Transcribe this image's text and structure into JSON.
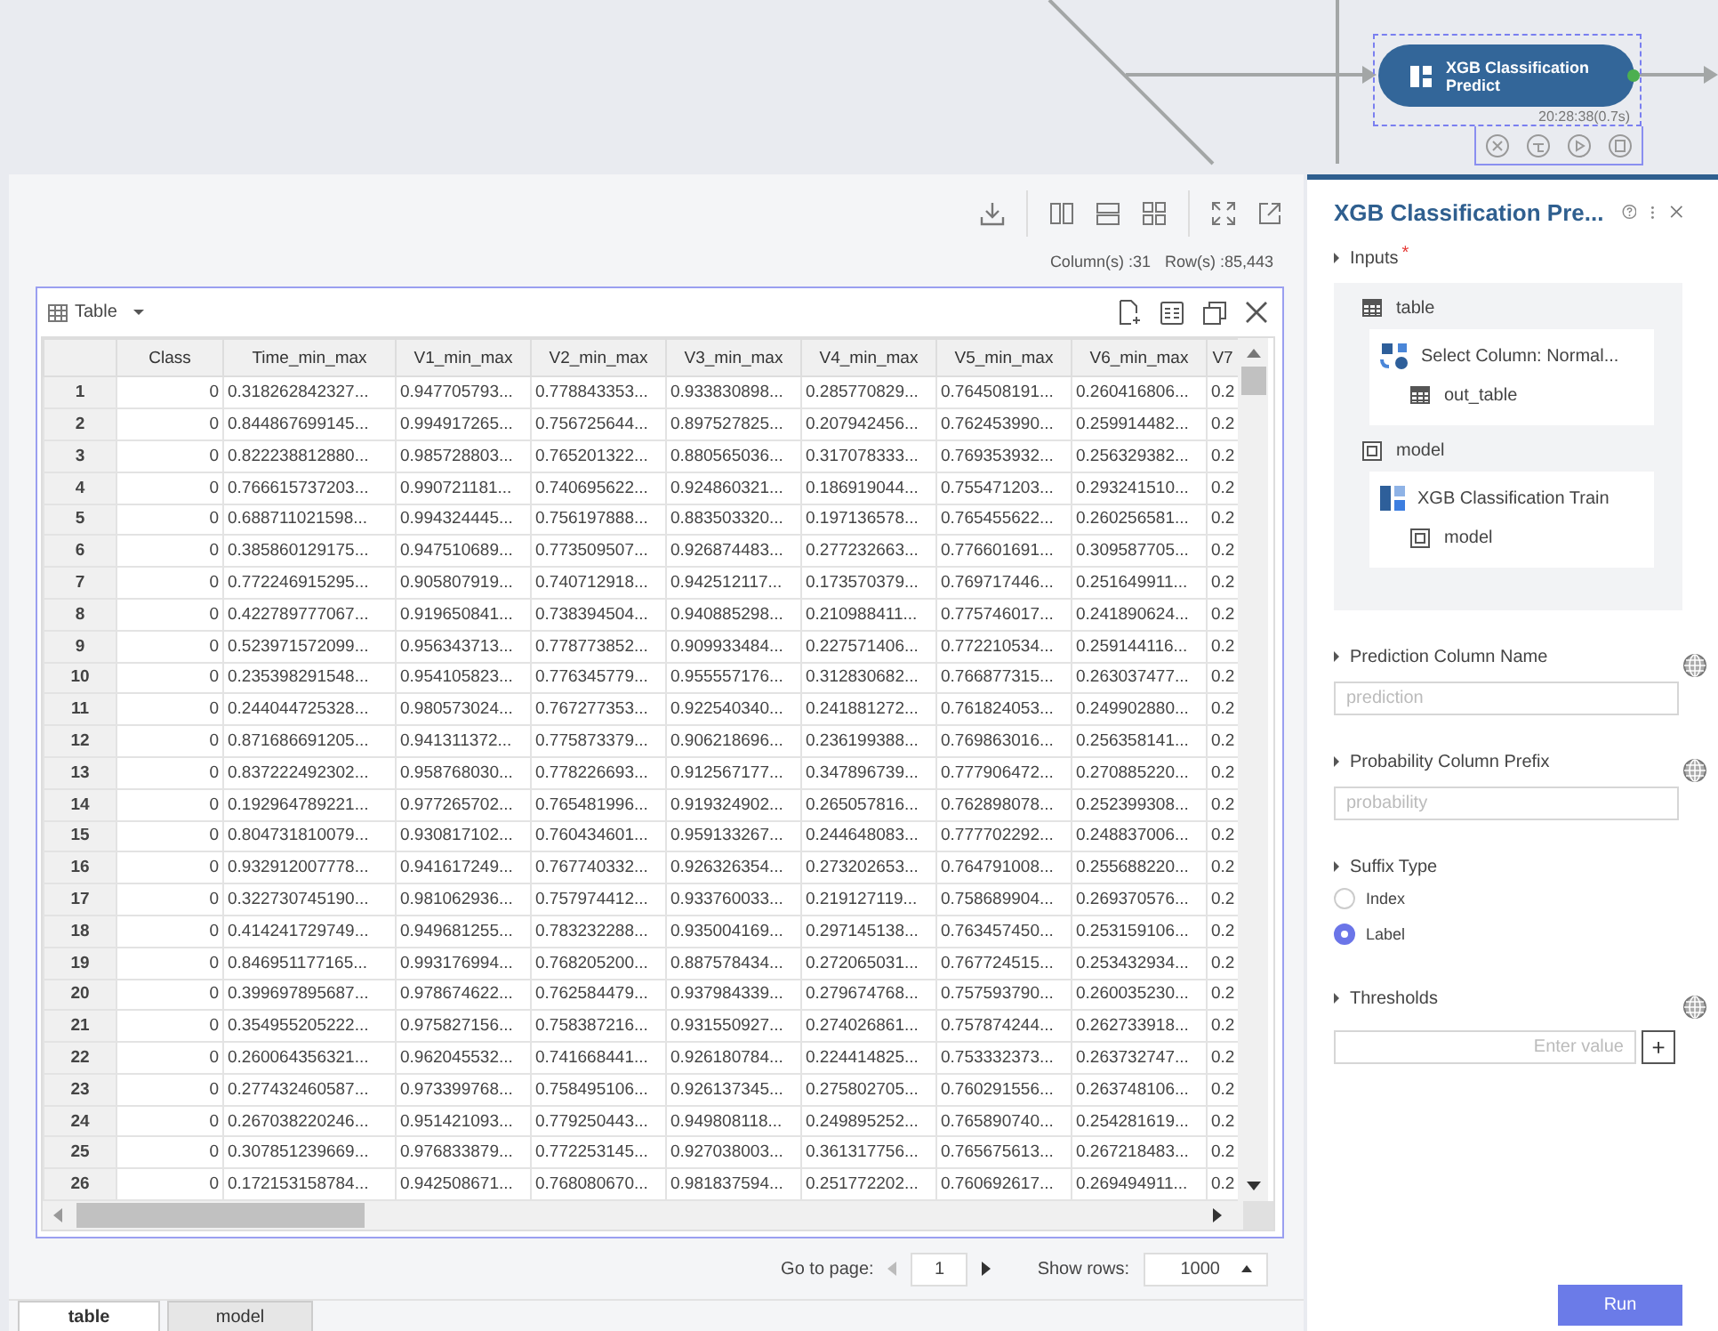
{
  "canvas": {
    "node": {
      "title": "XGB Classification Predict",
      "time": "20:28:38(0.7s)",
      "selected": true
    }
  },
  "result_panel": {
    "stats": {
      "columns": "Column(s) :31",
      "rows": "Row(s) :85,443"
    },
    "table": {
      "title": "Table",
      "columns": [
        "Class",
        "Time_min_max",
        "V1_min_max",
        "V2_min_max",
        "V3_min_max",
        "V4_min_max",
        "V5_min_max",
        "V6_min_max",
        "V7"
      ],
      "rows": [
        {
          "index": "1",
          "cells": [
            "0",
            "0.318262842327...",
            "0.947705793...",
            "0.778843353...",
            "0.933830898...",
            "0.285770829...",
            "0.764508191...",
            "0.260416806...",
            "0.2"
          ]
        },
        {
          "index": "2",
          "cells": [
            "0",
            "0.844867699145...",
            "0.994917265...",
            "0.756725644...",
            "0.897527825...",
            "0.207942456...",
            "0.762453990...",
            "0.259914482...",
            "0.2"
          ]
        },
        {
          "index": "3",
          "cells": [
            "0",
            "0.822238812880...",
            "0.985728803...",
            "0.765201322...",
            "0.880565036...",
            "0.317078333...",
            "0.769353932...",
            "0.256329382...",
            "0.2"
          ]
        },
        {
          "index": "4",
          "cells": [
            "0",
            "0.766615737203...",
            "0.990721181...",
            "0.740695622...",
            "0.924860321...",
            "0.186919044...",
            "0.755471203...",
            "0.293241510...",
            "0.2"
          ]
        },
        {
          "index": "5",
          "cells": [
            "0",
            "0.688711021598...",
            "0.994324445...",
            "0.756197888...",
            "0.883503320...",
            "0.197136578...",
            "0.765455622...",
            "0.260256581...",
            "0.2"
          ]
        },
        {
          "index": "6",
          "cells": [
            "0",
            "0.385860129175...",
            "0.947510689...",
            "0.773509507...",
            "0.926874483...",
            "0.277232663...",
            "0.776601691...",
            "0.309587705...",
            "0.2"
          ]
        },
        {
          "index": "7",
          "cells": [
            "0",
            "0.772246915295...",
            "0.905807919...",
            "0.740712918...",
            "0.942512117...",
            "0.173570379...",
            "0.769717446...",
            "0.251649911...",
            "0.2"
          ]
        },
        {
          "index": "8",
          "cells": [
            "0",
            "0.422789777067...",
            "0.919650841...",
            "0.738394504...",
            "0.940885298...",
            "0.210988411...",
            "0.775746017...",
            "0.241890624...",
            "0.2"
          ]
        },
        {
          "index": "9",
          "cells": [
            "0",
            "0.523971572099...",
            "0.956343713...",
            "0.778773852...",
            "0.909933484...",
            "0.227571406...",
            "0.772210534...",
            "0.259144116...",
            "0.2"
          ]
        },
        {
          "index": "10",
          "cells": [
            "0",
            "0.235398291548...",
            "0.954105823...",
            "0.776345779...",
            "0.955557176...",
            "0.312830682...",
            "0.766877315...",
            "0.263037477...",
            "0.2"
          ]
        },
        {
          "index": "11",
          "cells": [
            "0",
            "0.244044725328...",
            "0.980573024...",
            "0.767277353...",
            "0.922540340...",
            "0.241881272...",
            "0.761824053...",
            "0.249902880...",
            "0.2"
          ]
        },
        {
          "index": "12",
          "cells": [
            "0",
            "0.871686691205...",
            "0.941311372...",
            "0.775873379...",
            "0.906218696...",
            "0.236199388...",
            "0.769863016...",
            "0.256358141...",
            "0.2"
          ]
        },
        {
          "index": "13",
          "cells": [
            "0",
            "0.837222492302...",
            "0.958768030...",
            "0.778226693...",
            "0.912567177...",
            "0.347896739...",
            "0.777906472...",
            "0.270885220...",
            "0.2"
          ]
        },
        {
          "index": "14",
          "cells": [
            "0",
            "0.192964789221...",
            "0.977265702...",
            "0.765481996...",
            "0.919324902...",
            "0.265057816...",
            "0.762898078...",
            "0.252399308...",
            "0.2"
          ]
        },
        {
          "index": "15",
          "cells": [
            "0",
            "0.804731810079...",
            "0.930817102...",
            "0.760434601...",
            "0.959133267...",
            "0.244648083...",
            "0.777702292...",
            "0.248837006...",
            "0.2"
          ]
        },
        {
          "index": "16",
          "cells": [
            "0",
            "0.932912007778...",
            "0.941617249...",
            "0.767740332...",
            "0.926326354...",
            "0.273202653...",
            "0.764791008...",
            "0.255688220...",
            "0.2"
          ]
        },
        {
          "index": "17",
          "cells": [
            "0",
            "0.322730745190...",
            "0.981062936...",
            "0.757974412...",
            "0.933760033...",
            "0.219127119...",
            "0.758689904...",
            "0.269370576...",
            "0.2"
          ]
        },
        {
          "index": "18",
          "cells": [
            "0",
            "0.414241729749...",
            "0.949681255...",
            "0.783232288...",
            "0.935004169...",
            "0.297145138...",
            "0.763457450...",
            "0.253159106...",
            "0.2"
          ]
        },
        {
          "index": "19",
          "cells": [
            "0",
            "0.846951177165...",
            "0.993176994...",
            "0.768205200...",
            "0.887578434...",
            "0.272065031...",
            "0.767724515...",
            "0.253432934...",
            "0.2"
          ]
        },
        {
          "index": "20",
          "cells": [
            "0",
            "0.399697895687...",
            "0.978674622...",
            "0.762584479...",
            "0.937984339...",
            "0.279674768...",
            "0.757593790...",
            "0.260035230...",
            "0.2"
          ]
        },
        {
          "index": "21",
          "cells": [
            "0",
            "0.354955205222...",
            "0.975827156...",
            "0.758387216...",
            "0.931550927...",
            "0.274026861...",
            "0.757874244...",
            "0.262733918...",
            "0.2"
          ]
        },
        {
          "index": "22",
          "cells": [
            "0",
            "0.260064356321...",
            "0.962045532...",
            "0.741668441...",
            "0.926180784...",
            "0.224414825...",
            "0.753332373...",
            "0.263732747...",
            "0.2"
          ]
        },
        {
          "index": "23",
          "cells": [
            "0",
            "0.277432460587...",
            "0.973399768...",
            "0.758495106...",
            "0.926137345...",
            "0.275802705...",
            "0.760291556...",
            "0.263748106...",
            "0.2"
          ]
        },
        {
          "index": "24",
          "cells": [
            "0",
            "0.267038220246...",
            "0.951421093...",
            "0.779250443...",
            "0.949808118...",
            "0.249895252...",
            "0.765890740...",
            "0.254281619...",
            "0.2"
          ]
        },
        {
          "index": "25",
          "cells": [
            "0",
            "0.307851239669...",
            "0.976833879...",
            "0.772253145...",
            "0.927038003...",
            "0.361317756...",
            "0.765675613...",
            "0.267218483...",
            "0.2"
          ]
        },
        {
          "index": "26",
          "cells": [
            "0",
            "0.172153158784...",
            "0.942508671...",
            "0.768080670...",
            "0.981837594...",
            "0.251772202...",
            "0.760692617...",
            "0.269494911...",
            "0.2"
          ]
        }
      ]
    },
    "pagination": {
      "go_to_label": "Go to page:",
      "page": "1",
      "show_rows_label": "Show rows:",
      "show_rows": "1000"
    },
    "tabs": [
      {
        "label": "table",
        "selected": true
      },
      {
        "label": "model",
        "selected": false
      }
    ]
  },
  "properties": {
    "title": "XGB Classification Pre...",
    "inputs": {
      "label": "Inputs",
      "required_mark": "*",
      "ports": [
        {
          "name": "table",
          "kind": "table",
          "source": {
            "kind": "select",
            "name": "Select Column: Normal..."
          },
          "output": "out_table"
        },
        {
          "name": "model",
          "kind": "model",
          "source": {
            "kind": "train",
            "name": "XGB Classification Train"
          },
          "output": "model"
        }
      ]
    },
    "params": [
      {
        "kind": "text",
        "label": "Prediction Column Name",
        "placeholder": "prediction"
      },
      {
        "kind": "text",
        "label": "Probability Column Prefix",
        "placeholder": "probability"
      },
      {
        "kind": "radio",
        "label": "Suffix Type",
        "options": [
          {
            "label": "Index",
            "selected": false
          },
          {
            "label": "Label",
            "selected": true
          }
        ]
      },
      {
        "kind": "list",
        "label": "Thresholds",
        "placeholder": "Enter value",
        "add": "+"
      }
    ],
    "run": "Run"
  }
}
